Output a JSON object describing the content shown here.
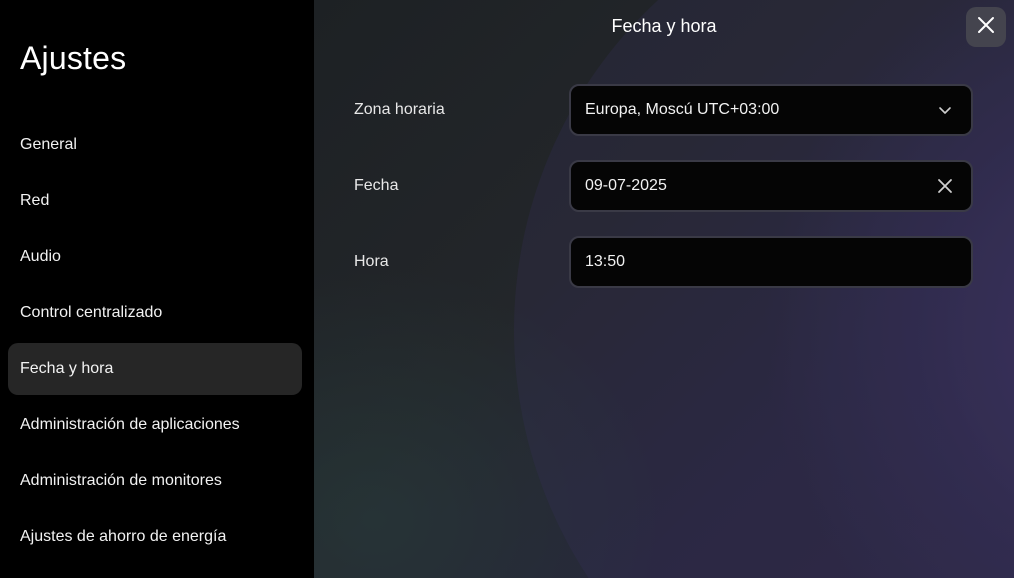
{
  "sidebar": {
    "title": "Ajustes",
    "items": [
      {
        "label": "General"
      },
      {
        "label": "Red"
      },
      {
        "label": "Audio"
      },
      {
        "label": "Control centralizado"
      },
      {
        "label": "Fecha y hora",
        "active": true
      },
      {
        "label": "Administración de aplicaciones"
      },
      {
        "label": "Administración de monitores"
      },
      {
        "label": "Ajustes de ahorro de energía"
      }
    ]
  },
  "main": {
    "title": "Fecha y hora",
    "timezone": {
      "label": "Zona horaria",
      "value": "Europa, Moscú UTC+03:00",
      "icon": "chevron-down-icon"
    },
    "date": {
      "label": "Fecha",
      "value": "09-07-2025",
      "icon": "clear-icon"
    },
    "time": {
      "label": "Hora",
      "value": "13:50"
    }
  },
  "icons": {
    "close": "close-icon"
  },
  "colors": {
    "sidebar_bg": "#000000",
    "active_item_bg": "#262626",
    "field_bg": "#050505",
    "field_border": "#3a3a46",
    "close_button_bg": "#44444e"
  }
}
